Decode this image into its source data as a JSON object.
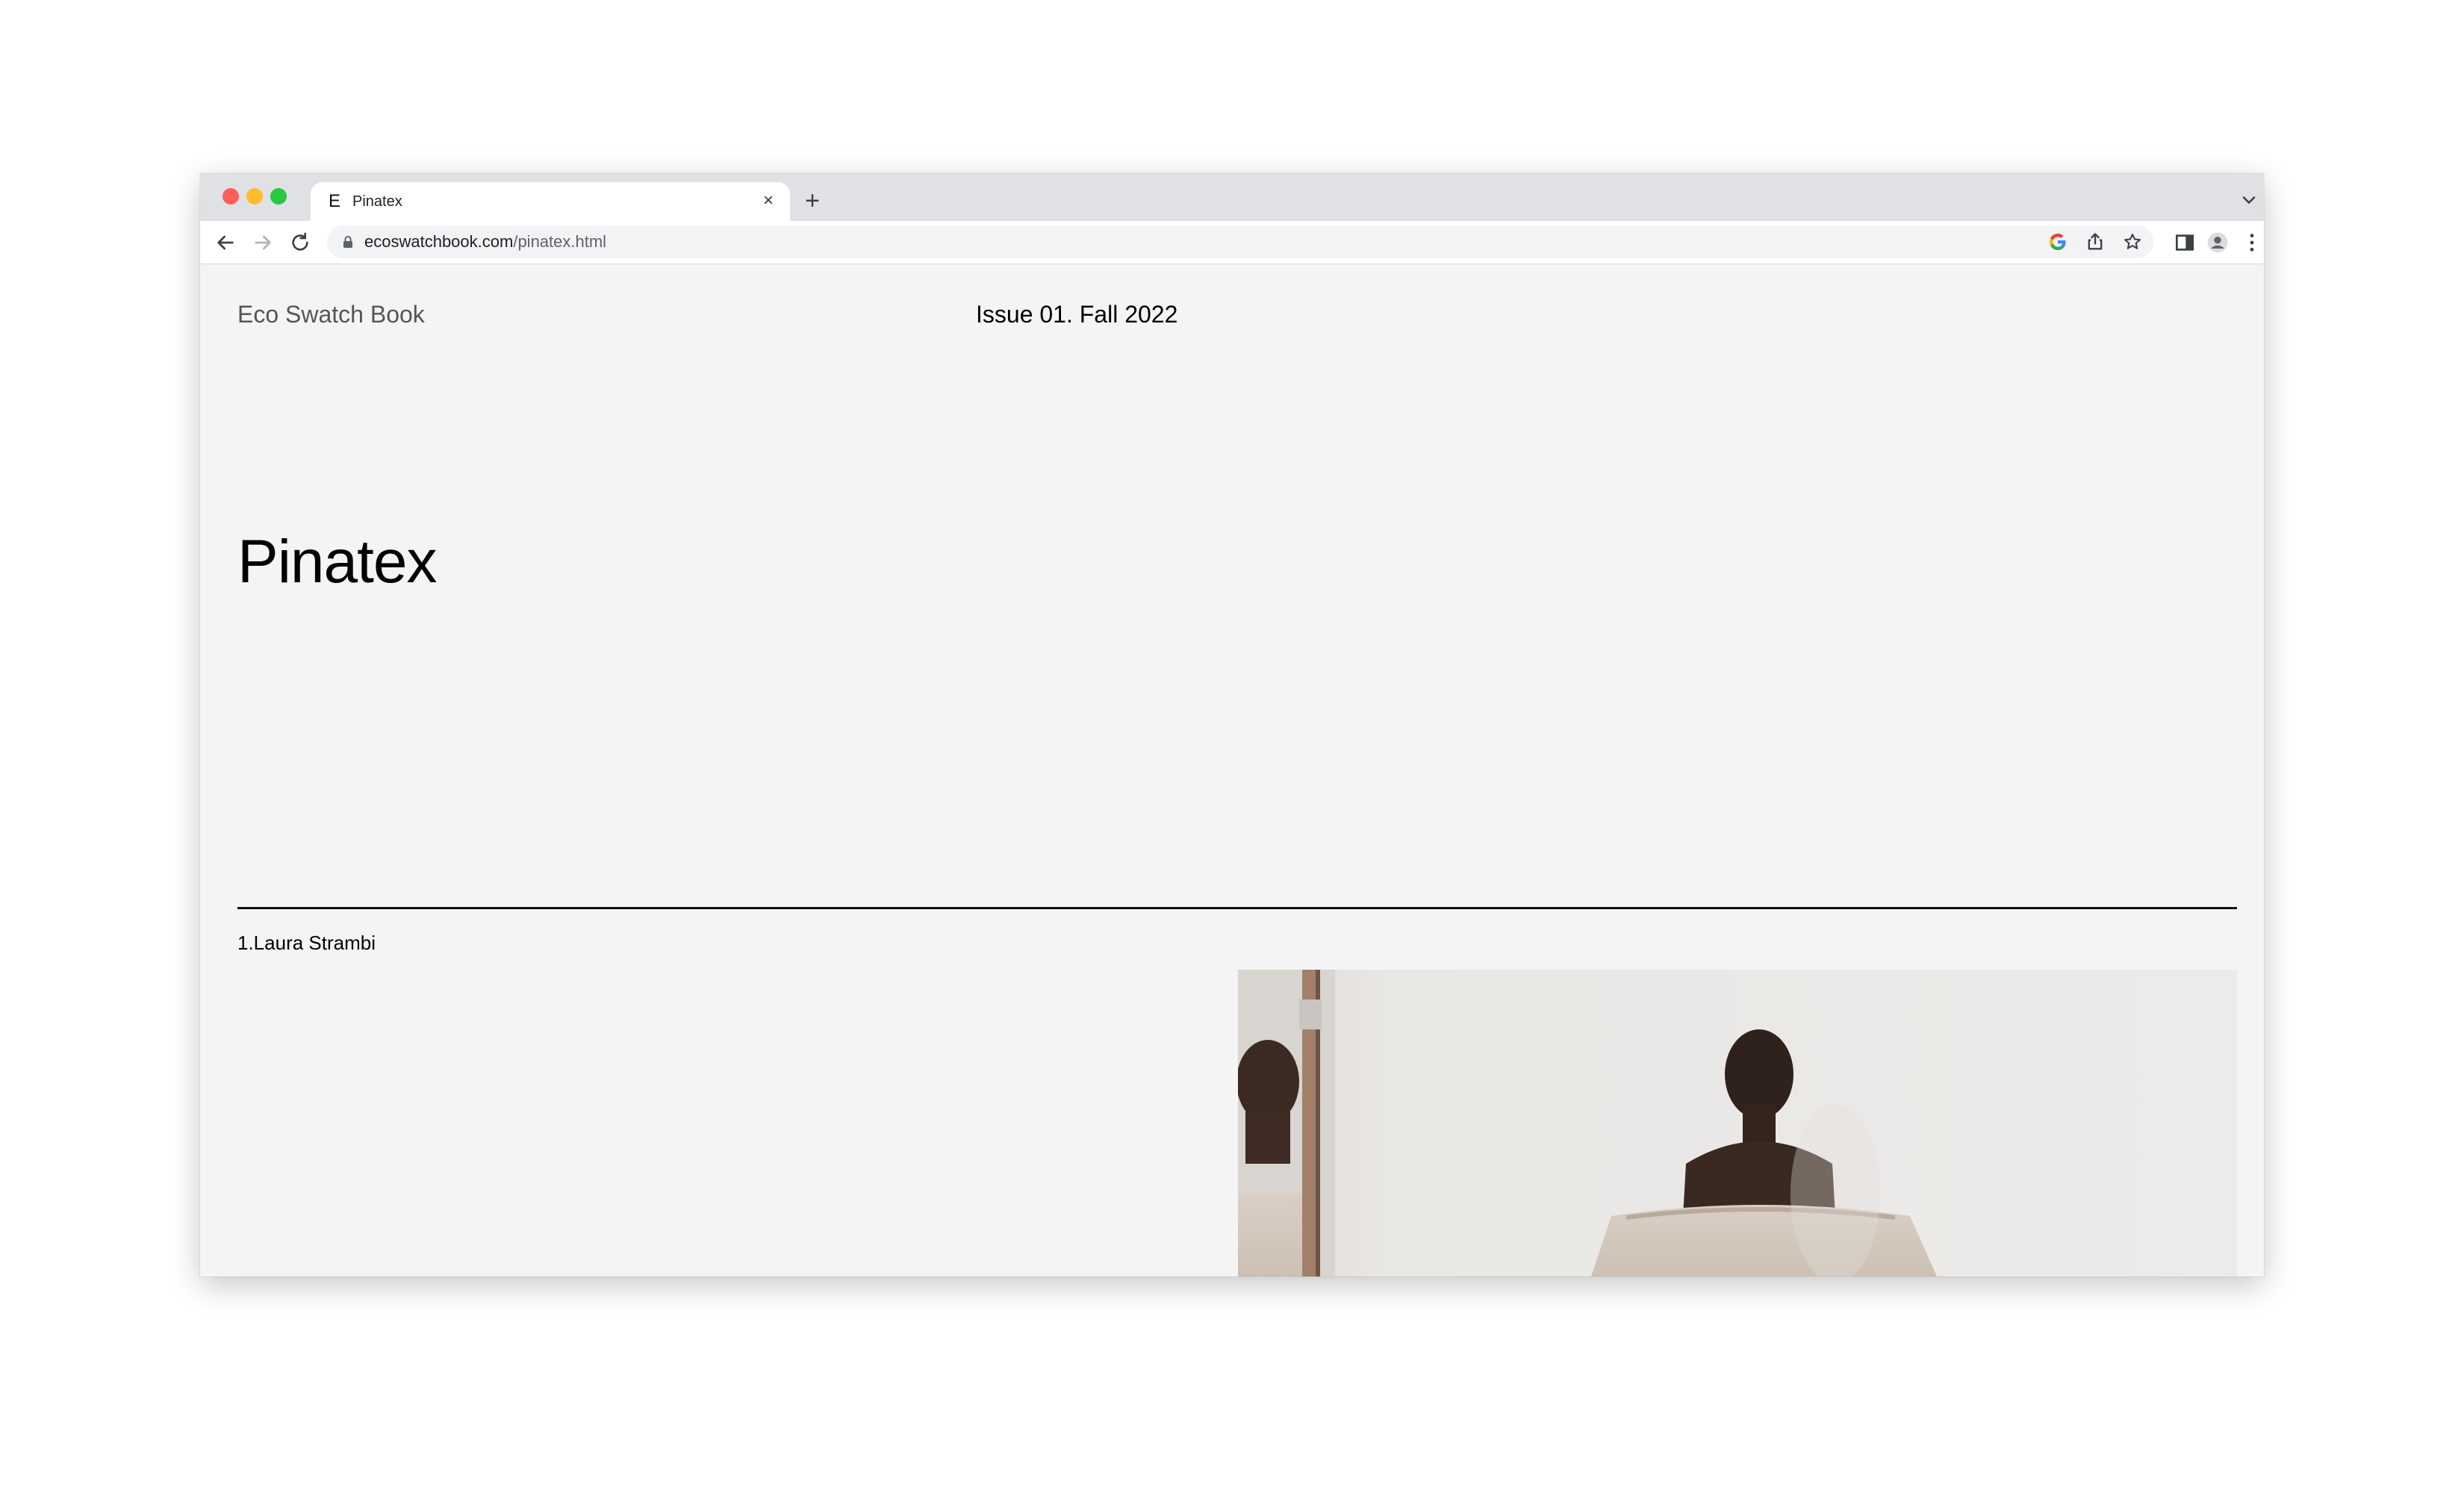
{
  "browser": {
    "tab": {
      "favicon_letter": "E",
      "title": "Pinatex"
    },
    "new_tab_symbol": "+",
    "close_symbol": "×",
    "url": {
      "domain": "ecoswatchbook.com",
      "path": "/pinatex.html"
    }
  },
  "page": {
    "site_name": "Eco Swatch Book",
    "issue": "Issue 01. Fall 2022",
    "title": "Pinatex",
    "items": [
      {
        "label": "1.Laura Strambi"
      }
    ]
  },
  "colors": {
    "page_background": "#f4f4f4",
    "tabstrip": "#dfe1e5",
    "rule": "#111111",
    "site_name_text": "#555555"
  }
}
